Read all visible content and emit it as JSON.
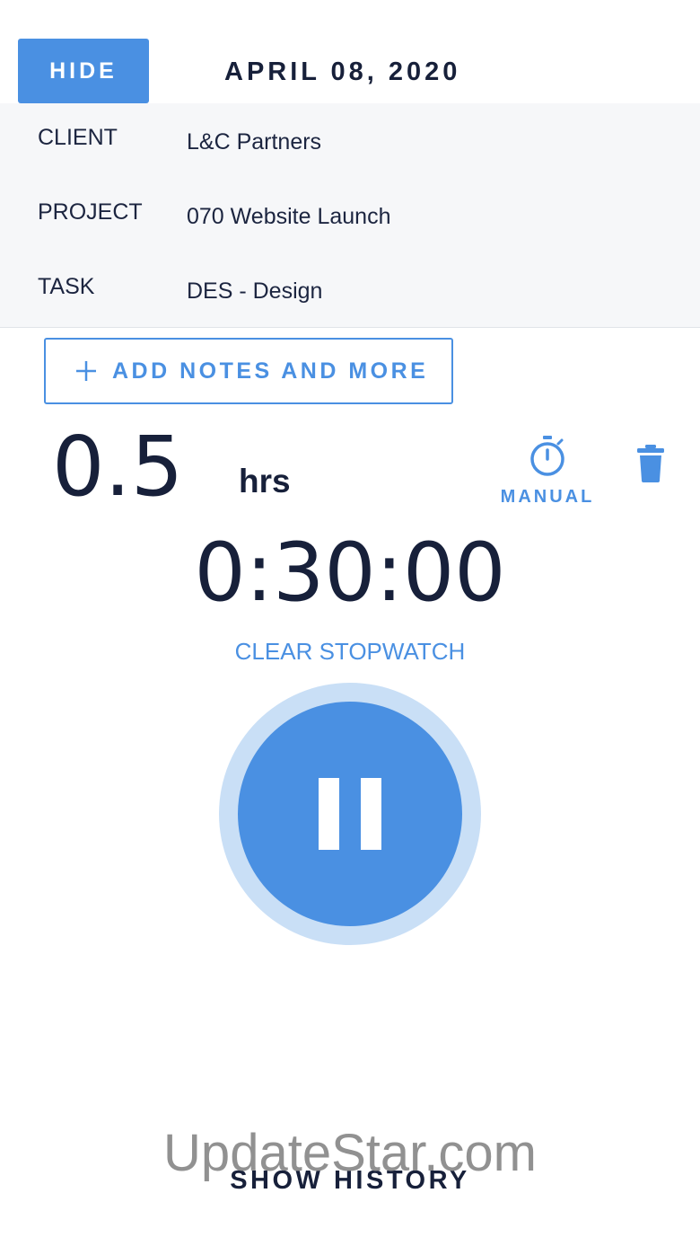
{
  "header": {
    "hide_label": "HIDE",
    "date": "APRIL 08, 2020"
  },
  "fields": {
    "client": {
      "label": "CLIENT",
      "value": "L&C Partners"
    },
    "project": {
      "label": "PROJECT",
      "value": "070 Website Launch"
    },
    "task": {
      "label": "TASK",
      "value": "DES - Design"
    }
  },
  "notes": {
    "add_label": "ADD NOTES AND MORE",
    "icon": "plus-icon"
  },
  "hours": {
    "value": "0.5",
    "unit": "hrs"
  },
  "manual": {
    "label": "MANUAL",
    "icon": "stopwatch-icon"
  },
  "trash": {
    "icon": "trash-icon"
  },
  "timer": {
    "display": "0:30:00",
    "clear_label": "CLEAR STOPWATCH"
  },
  "pause": {
    "icon": "pause-icon"
  },
  "footer": {
    "show_history_label": "SHOW HISTORY"
  },
  "watermark": {
    "text": "UpdateStar.com"
  },
  "colors": {
    "accent": "#4a90e2",
    "accent_light": "#c9dff6",
    "text_dark": "#17203a",
    "row_background": "#f6f7f9"
  }
}
